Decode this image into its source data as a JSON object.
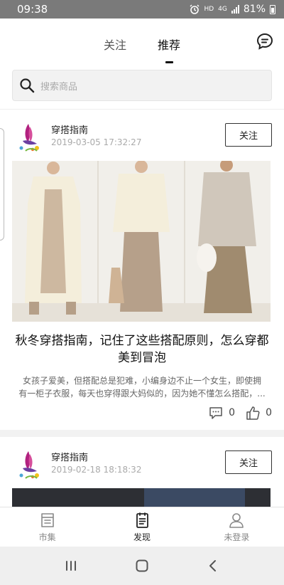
{
  "status_bar": {
    "time": "09:38",
    "hd": "HD",
    "network": "4G",
    "battery": "81%"
  },
  "top_tabs": {
    "follow": "关注",
    "recommend": "推荐",
    "active": "recommend"
  },
  "search": {
    "placeholder": "搜索商品"
  },
  "posts": [
    {
      "author": "穿搭指南",
      "time": "2019-03-05 17:32:27",
      "follow_label": "关注",
      "title": "秋冬穿搭指南，记住了这些搭配原则，怎么穿都美到冒泡",
      "summary_line1": "女孩子爱美，但搭配总是犯难，小编身边不止一个女生，即使拥",
      "summary_line2": "有一柜子衣服，每天也穿得跟大妈似的，因为她不懂怎么搭配，...",
      "comments": "0",
      "likes": "0"
    },
    {
      "author": "穿搭指南",
      "time": "2019-02-18 18:18:32",
      "follow_label": "关注"
    }
  ],
  "bottom_nav": [
    {
      "label": "市集",
      "icon": "market-icon"
    },
    {
      "label": "发现",
      "icon": "discover-icon"
    },
    {
      "label": "未登录",
      "icon": "user-icon"
    }
  ],
  "colors": {
    "status_bar": "#7a7a7a",
    "accent": "#111111",
    "muted": "#aaaaaa"
  }
}
